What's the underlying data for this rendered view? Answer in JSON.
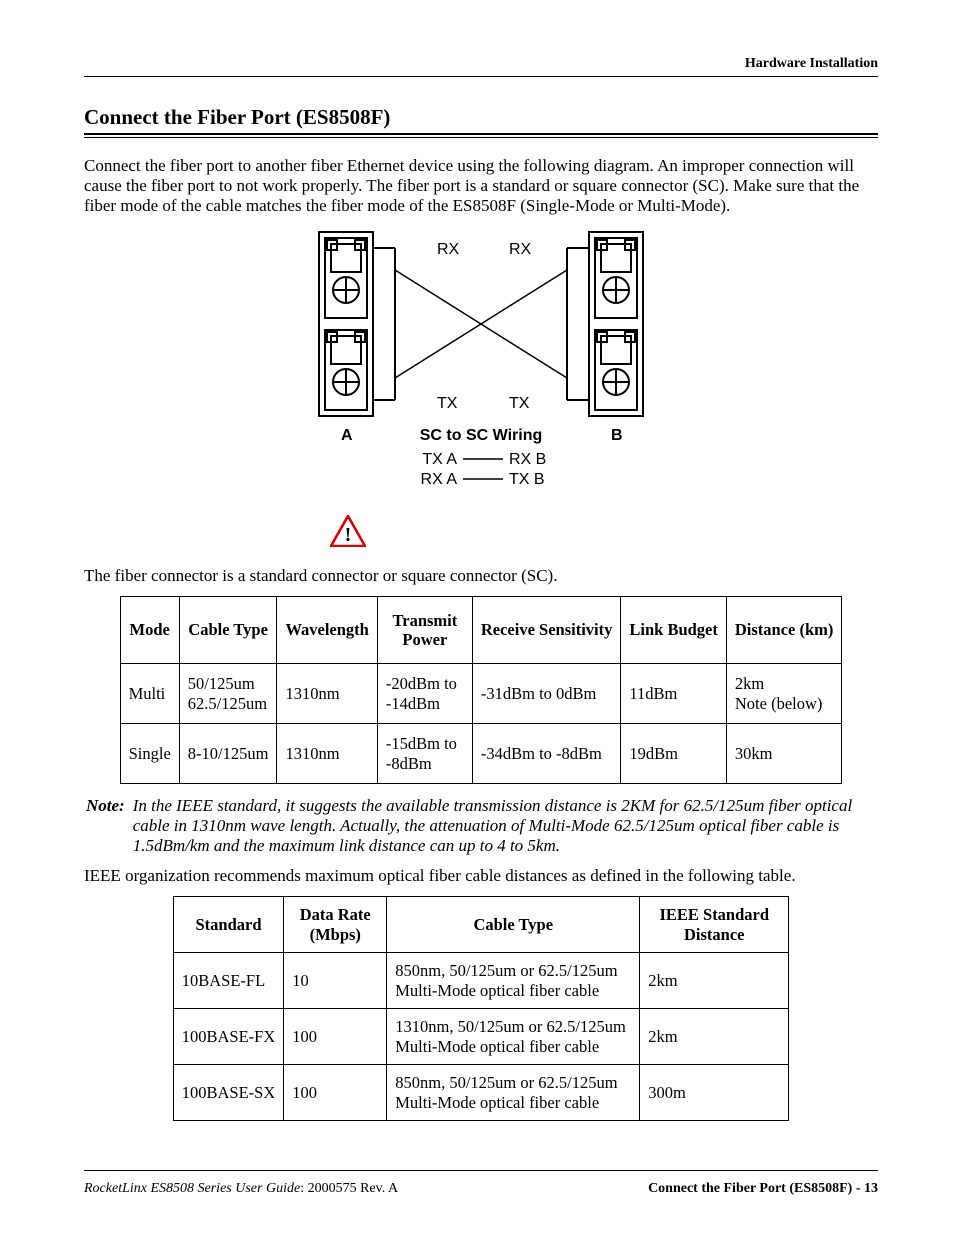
{
  "header": {
    "running": "Hardware Installation"
  },
  "section": {
    "title": "Connect the Fiber Port (ES8508F)",
    "intro": "Connect the fiber port to another fiber Ethernet device using the following diagram. An improper connection will cause the fiber port to not work properly. The fiber port is a standard or square connector (SC). Make sure that the fiber mode of the cable matches the fiber mode of the ES8508F (Single-Mode or Multi-Mode)."
  },
  "diagram": {
    "rx": "RX",
    "tx": "TX",
    "a": "A",
    "b": "B",
    "title": "SC to SC Wiring",
    "line1_left": "TX A",
    "line1_right": "RX B",
    "line2_left": "RX A",
    "line2_right": "TX B"
  },
  "connector_text": "The fiber connector is a standard connector or square connector (SC).",
  "table1": {
    "headers": [
      "Mode",
      "Cable Type",
      "Wavelength",
      "Transmit Power",
      "Receive Sensitivity",
      "Link Budget",
      "Distance (km)"
    ],
    "rows": [
      {
        "mode": "Multi",
        "cable": "50/125um\n62.5/125um",
        "wavelength": "1310nm",
        "transmit": "-20dBm to -14dBm",
        "receive": "-31dBm to 0dBm",
        "budget": "11dBm",
        "distance": "2km\nNote (below)"
      },
      {
        "mode": "Single",
        "cable": "8-10/125um",
        "wavelength": "1310nm",
        "transmit": "-15dBm to -8dBm",
        "receive": "-34dBm to -8dBm",
        "budget": "19dBm",
        "distance": "30km"
      }
    ]
  },
  "note": {
    "label": "Note:",
    "text": "In the IEEE standard, it suggests the available transmission distance is 2KM for 62.5/125um fiber optical cable in 1310nm wave length. Actually, the attenuation of Multi-Mode 62.5/125um optical fiber cable is 1.5dBm/km and the maximum link distance can up to 4 to 5km."
  },
  "ieee_text": "IEEE organization recommends maximum optical fiber cable distances as defined in the following table.",
  "table2": {
    "headers": [
      "Standard",
      "Data Rate (Mbps)",
      "Cable Type",
      "IEEE Standard Distance"
    ],
    "rows": [
      {
        "standard": "10BASE-FL",
        "rate": "10",
        "cable": "850nm, 50/125um or 62.5/125um\nMulti-Mode optical fiber cable",
        "distance": "2km"
      },
      {
        "standard": "100BASE-FX",
        "rate": "100",
        "cable": "1310nm, 50/125um or 62.5/125um\nMulti-Mode optical fiber cable",
        "distance": "2km"
      },
      {
        "standard": "100BASE-SX",
        "rate": "100",
        "cable": "850nm, 50/125um or 62.5/125um\nMulti-Mode optical fiber cable",
        "distance": "300m"
      }
    ]
  },
  "footer": {
    "left_italic": "RocketLinx ES8508 Series  User Guide",
    "left_rest": ": 2000575 Rev. A",
    "right": "Connect the Fiber Port (ES8508F) - 13"
  }
}
